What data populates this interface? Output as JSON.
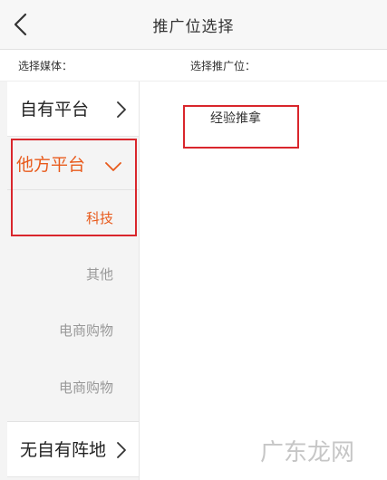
{
  "header": {
    "title": "推广位选择"
  },
  "subheader": {
    "left_label": "选择媒体：",
    "right_label": "选择推广位："
  },
  "sidebar": {
    "own_platform": "自有平台",
    "other_platform": "他方平台",
    "sub_items": [
      "科技",
      "其他",
      "电商购物",
      "电商购物"
    ],
    "no_platform": "无自有阵地"
  },
  "main": {
    "option": "经验推拿"
  },
  "watermark": "广东龙网",
  "colors": {
    "accent": "#e85a1b",
    "highlight_border": "#d9262c"
  },
  "icons": {
    "back": "chevron-left-icon",
    "collapsed": "chevron-right-icon",
    "expanded": "chevron-down-icon"
  }
}
